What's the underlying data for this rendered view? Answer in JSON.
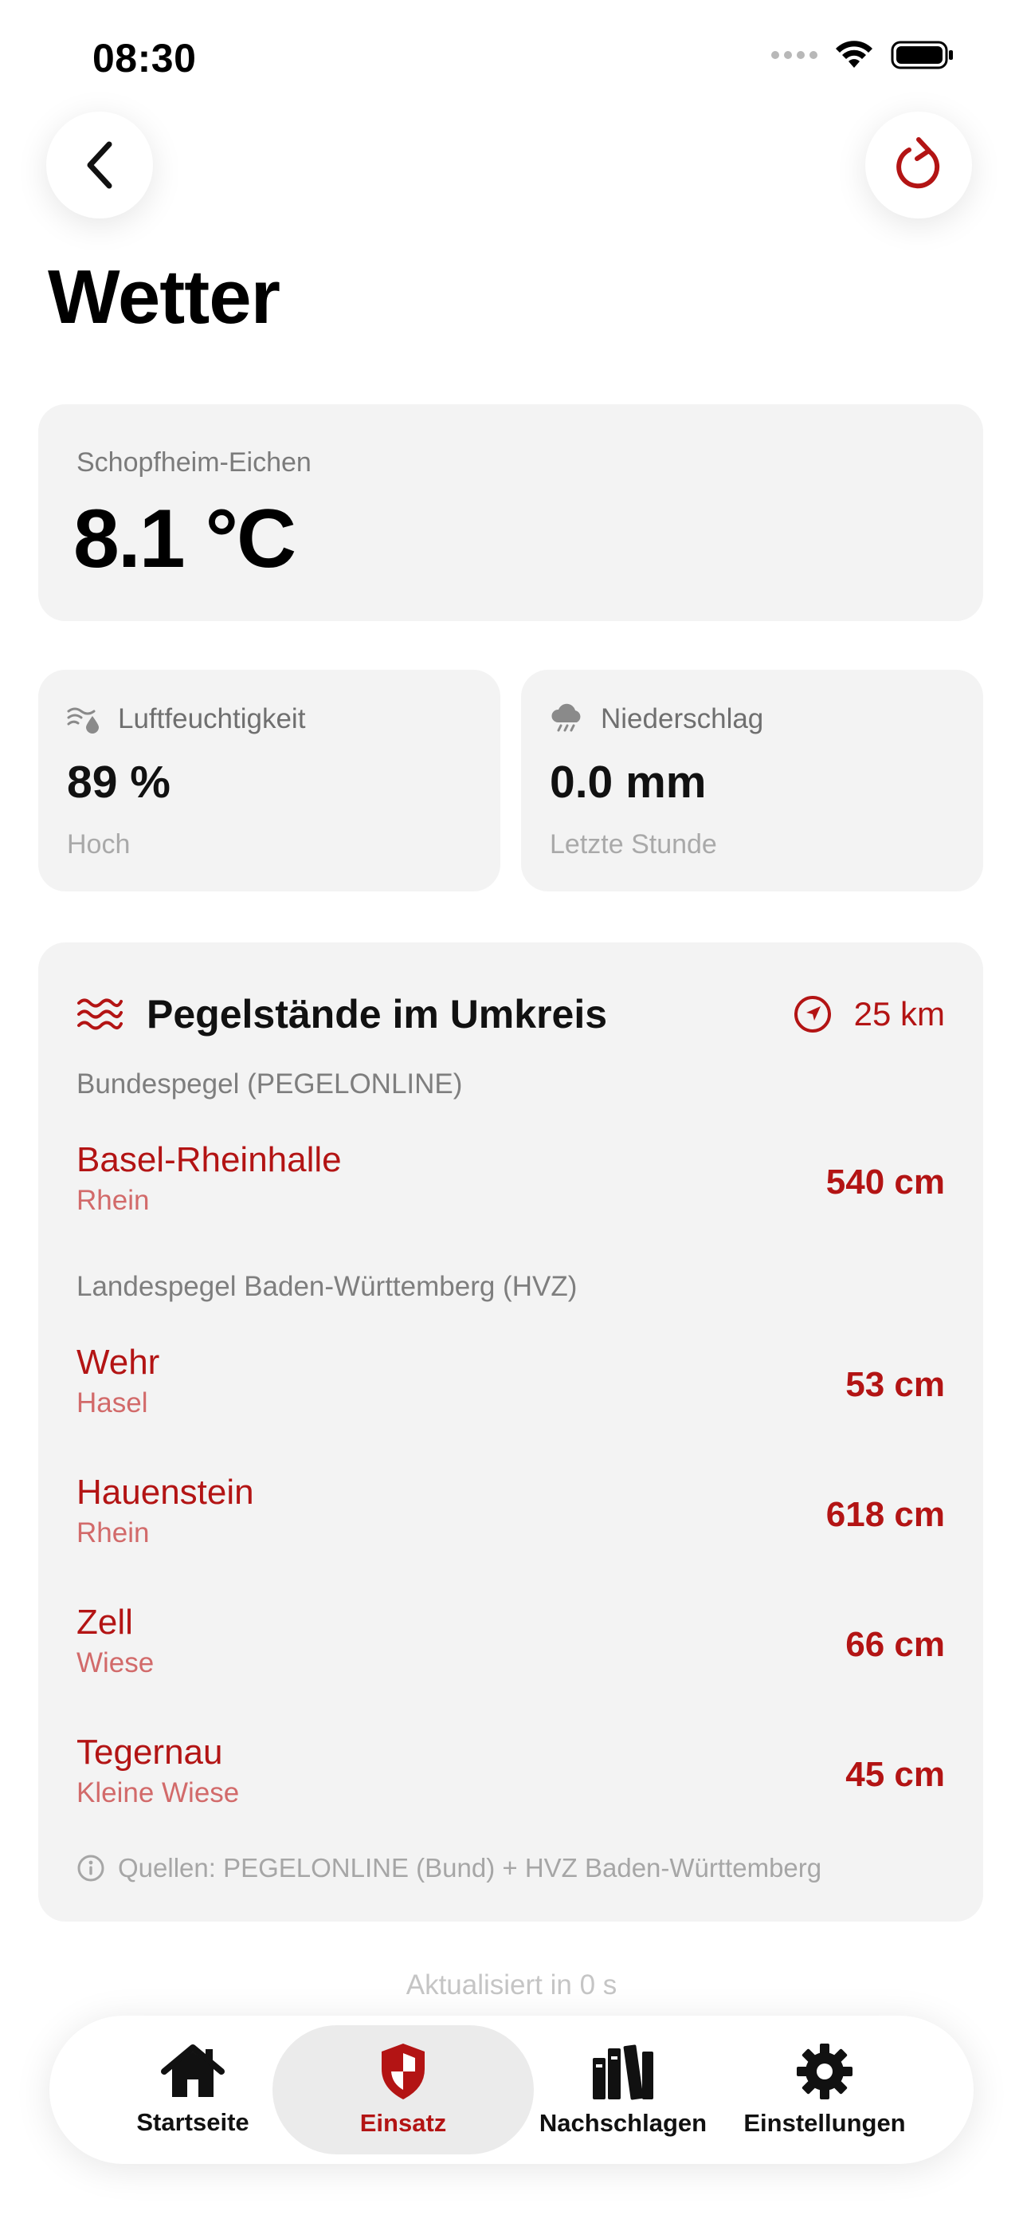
{
  "status_bar": {
    "time": "08:30"
  },
  "header": {
    "title": "Wetter"
  },
  "temperature": {
    "location": "Schopfheim-Eichen",
    "value": "8.1 °C"
  },
  "humidity": {
    "label": "Luftfeuchtigkeit",
    "value": "89 %",
    "sub": "Hoch"
  },
  "precipitation": {
    "label": "Niederschlag",
    "value": "0.0 mm",
    "sub": "Letzte Stunde"
  },
  "gauges": {
    "title": "Pegelstände im Umkreis",
    "radius": "25 km",
    "groups": [
      {
        "label": "Bundespegel (PEGELONLINE)",
        "stations": [
          {
            "name": "Basel-Rheinhalle",
            "river": "Rhein",
            "level": "540 cm"
          }
        ]
      },
      {
        "label": "Landespegel Baden-Württemberg (HVZ)",
        "stations": [
          {
            "name": "Wehr",
            "river": "Hasel",
            "level": "53 cm"
          },
          {
            "name": "Hauenstein",
            "river": "Rhein",
            "level": "618 cm"
          },
          {
            "name": "Zell",
            "river": "Wiese",
            "level": "66 cm"
          },
          {
            "name": "Tegernau",
            "river": "Kleine Wiese",
            "level": "45 cm"
          }
        ]
      }
    ],
    "source": "Quellen: PEGELONLINE (Bund) + HVZ Baden-Württemberg"
  },
  "updated": "Aktualisiert in 0 s",
  "tabs": [
    {
      "label": "Startseite",
      "icon": "home-icon"
    },
    {
      "label": "Einsatz",
      "icon": "shield-icon",
      "active": true
    },
    {
      "label": "Nachschlagen",
      "icon": "books-icon"
    },
    {
      "label": "Einstellungen",
      "icon": "gear-icon"
    }
  ],
  "colors": {
    "accent": "#b31414",
    "card": "#f3f3f3",
    "muted": "#7e7e7e"
  }
}
